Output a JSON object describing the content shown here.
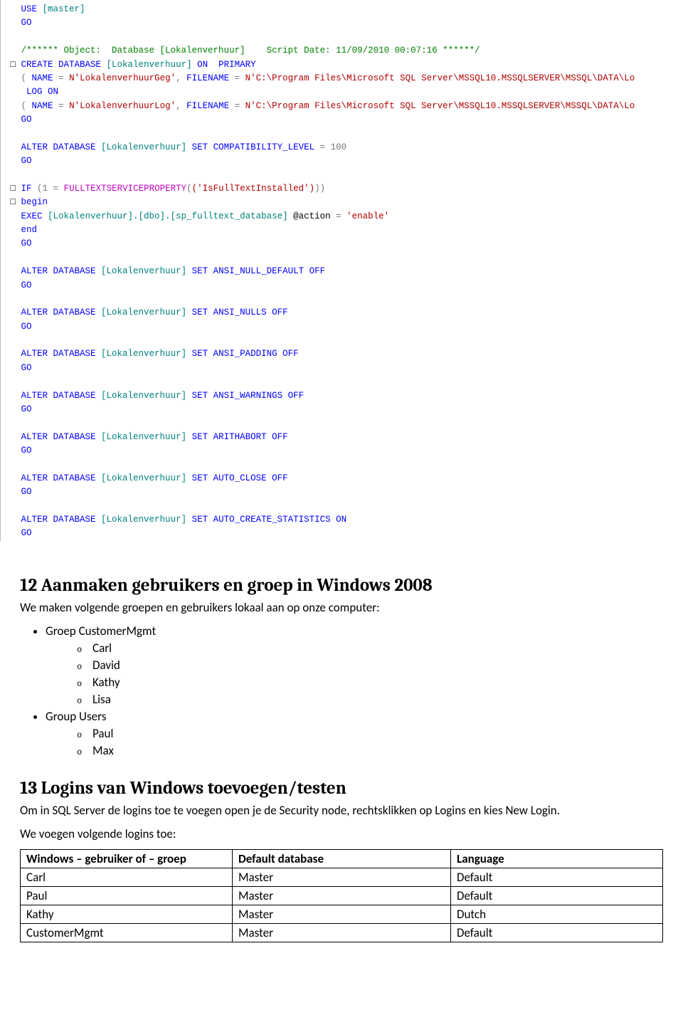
{
  "sql": {
    "line1_kw1": "USE ",
    "line1_id": "[master]",
    "go": "GO",
    "comment": "/****** Object:  Database [Lokalenverhuur]    Script Date: 11/09/2010 00:07:16 ******/",
    "create1": "CREATE DATABASE ",
    "create_id": "[Lokalenverhuur] ",
    "create2": "ON  PRIMARY",
    "paren_open": "( ",
    "name_kw": "NAME ",
    "eq": "= ",
    "name1_str": "N'LokalenverhuurGeg'",
    "comma": ", ",
    "fname_kw": "FILENAME ",
    "fname1_str": "N'C:\\Program Files\\Microsoft SQL Server\\MSSQL10.MSSQLSERVER\\MSSQL\\DATA\\Lo",
    "logon": "LOG ON",
    "name2_str": "N'LokalenverhuurLog'",
    "fname2_str": "N'C:\\Program Files\\Microsoft SQL Server\\MSSQL10.MSSQLSERVER\\MSSQL\\DATA\\Lo",
    "alter_pre": "ALTER DATABASE ",
    "alter_id": "[Lokalenverhuur] ",
    "set_kw": "SET ",
    "compat": "COMPATIBILITY_LEVEL ",
    "compat_val": "= 100",
    "if_kw": "IF ",
    "if_open": "(1 ",
    "if_eq": "= ",
    "ftprop": "FULLTEXTSERVICEPROPERTY",
    "ft_args": "('IsFullTextInstalled')",
    "if_close": ")",
    "begin": "begin",
    "exec": "EXEC ",
    "exec_target": "[Lokalenverhuur].[dbo].[sp_fulltext_database] ",
    "action": "@action ",
    "enable": "'enable'",
    "end": "end",
    "opt_ansi_null_default": "ANSI_NULL_DEFAULT ",
    "off": "OFF",
    "opt_ansi_nulls": "ANSI_NULLS ",
    "opt_ansi_padding": "ANSI_PADDING ",
    "opt_ansi_warnings": "ANSI_WARNINGS ",
    "opt_arithabort": "ARITHABORT ",
    "opt_auto_close": "AUTO_CLOSE ",
    "opt_auto_create_stats": "AUTO_CREATE_STATISTICS ",
    "on": "ON"
  },
  "section12": {
    "heading": "12  Aanmaken gebruikers en groep in Windows 2008",
    "intro": "We maken volgende groepen en gebruikers lokaal aan op onze computer:",
    "group1": "Groep CustomerMgmt",
    "g1_users": [
      "Carl",
      "David",
      "Kathy",
      "Lisa"
    ],
    "group2": "Group Users",
    "g2_users": [
      "Paul",
      "Max"
    ]
  },
  "section13": {
    "heading": "13  Logins van Windows toevoegen/testen",
    "intro": "Om in SQL Server de logins toe te voegen open je de Security node, rechtsklikken op Logins en kies New Login.",
    "intro2": "We voegen volgende logins toe:",
    "headers": [
      "Windows – gebruiker of – groep",
      "Default database",
      "Language"
    ],
    "rows": [
      [
        "Carl",
        "Master",
        "Default"
      ],
      [
        "Paul",
        "Master",
        "Default"
      ],
      [
        "Kathy",
        "Master",
        "Dutch"
      ],
      [
        "CustomerMgmt",
        "Master",
        "Default"
      ]
    ]
  }
}
